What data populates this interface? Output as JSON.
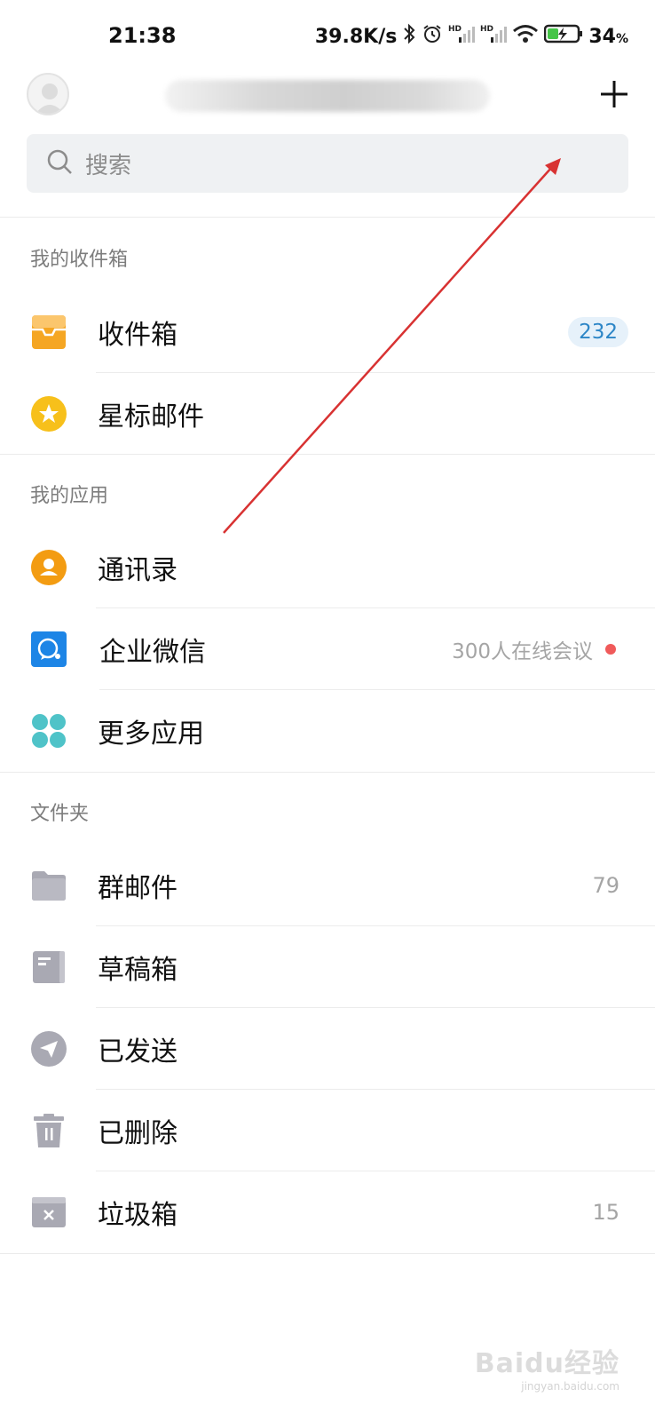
{
  "status_bar": {
    "time": "21:38",
    "net_speed": "39.8K/s",
    "battery": "34",
    "battery_unit": "%",
    "hd_label": "HD",
    "icons": [
      "bluetooth-icon",
      "alarm-icon",
      "signal-hd-icon",
      "signal-hd-icon",
      "wifi-icon",
      "battery-charging-icon"
    ]
  },
  "header": {
    "avatar_icon": "user-avatar-icon",
    "add_icon": "plus-icon"
  },
  "search": {
    "placeholder": "搜索",
    "icon": "search-icon"
  },
  "sections": {
    "inbox_title": "我的收件箱",
    "apps_title": "我的应用",
    "folders_title": "文件夹"
  },
  "inbox_items": [
    {
      "label": "收件箱",
      "icon": "inbox-tray-icon",
      "badge": "232"
    },
    {
      "label": "星标邮件",
      "icon": "star-icon"
    }
  ],
  "app_items": [
    {
      "label": "通讯录",
      "icon": "contacts-icon"
    },
    {
      "label": "企业微信",
      "icon": "wecom-icon",
      "note": "300人在线会议"
    },
    {
      "label": "更多应用",
      "icon": "more-apps-icon"
    }
  ],
  "folder_items": [
    {
      "label": "群邮件",
      "icon": "folder-icon",
      "count": "79"
    },
    {
      "label": "草稿箱",
      "icon": "draft-icon"
    },
    {
      "label": "已发送",
      "icon": "sent-plane-icon"
    },
    {
      "label": "已删除",
      "icon": "trash-icon"
    },
    {
      "label": "垃圾箱",
      "icon": "spam-box-icon",
      "count": "15"
    }
  ],
  "colors": {
    "inbox": "#f5a623",
    "star": "#f7c01b",
    "contacts": "#f39c12",
    "wecom": "#1d85e6",
    "more_apps": "#4fc3c8",
    "folder_gray": "#a9a9b3",
    "badge_bg": "#e6f1fa",
    "badge_text": "#2d86c7",
    "annotation_arrow": "#d83232"
  },
  "watermark": {
    "logo": "Baidu经验",
    "url": "jingyan.baidu.com"
  }
}
